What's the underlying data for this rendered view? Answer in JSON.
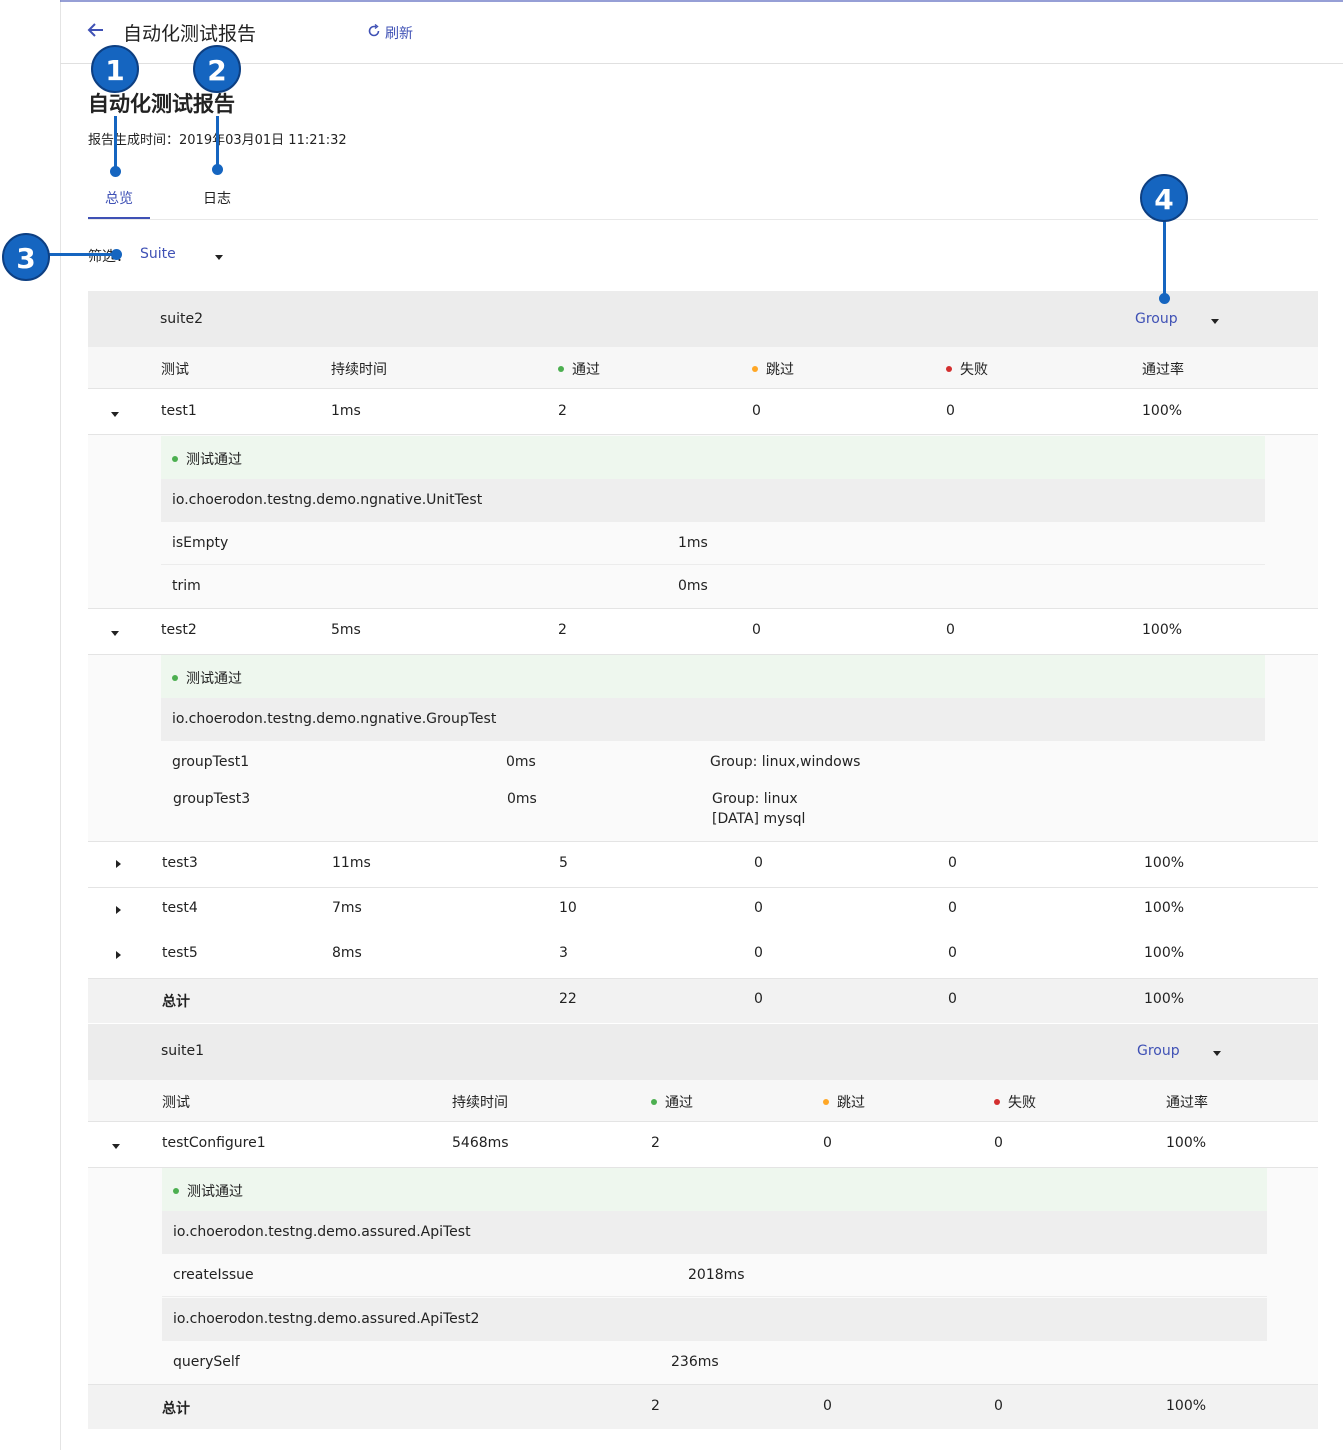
{
  "header": {
    "back_icon": "arrow-left-icon",
    "title": "自动化测试报告",
    "refresh_label": "刷新",
    "refresh_icon": "refresh-icon"
  },
  "page": {
    "title": "自动化测试报告",
    "generated_time": "报告生成时间：2019年03月01日 11:21:32"
  },
  "tabs": [
    {
      "label": "总览",
      "active": true
    },
    {
      "label": "日志",
      "active": false
    }
  ],
  "filter": {
    "label": "筛选：",
    "value": "Suite"
  },
  "colors": {
    "accent": "#3f51b5",
    "pass": "#4caf50",
    "skip": "#ffa726",
    "fail": "#d32f2f",
    "callout": "#1565c0"
  },
  "callouts": [
    "1",
    "2",
    "3",
    "4"
  ],
  "suites": [
    {
      "name": "suite2",
      "group_label": "Group",
      "columns": [
        "测试",
        "持续时间",
        "通过",
        "跳过",
        "失败",
        "通过率"
      ],
      "rows": [
        {
          "name": "test1",
          "duration": "1ms",
          "pass": "2",
          "skip": "0",
          "fail": "0",
          "rate": "100%",
          "expanded": true,
          "detail": {
            "status": "测试通过",
            "classes": [
              {
                "name": "io.choerodon.testng.demo.ngnative.UnitTest",
                "methods": [
                  {
                    "name": "isEmpty",
                    "duration": "1ms"
                  },
                  {
                    "name": "trim",
                    "duration": "0ms"
                  }
                ]
              }
            ]
          }
        },
        {
          "name": "test2",
          "duration": "5ms",
          "pass": "2",
          "skip": "0",
          "fail": "0",
          "rate": "100%",
          "expanded": true,
          "detail": {
            "status": "测试通过",
            "classes": [
              {
                "name": "io.choerodon.testng.demo.ngnative.GroupTest",
                "methods": [
                  {
                    "name": "groupTest1",
                    "duration": "0ms",
                    "info": "Group: linux,windows"
                  },
                  {
                    "name": "groupTest3",
                    "duration": "0ms",
                    "info": "Group: linux",
                    "info2": "[DATA] mysql"
                  }
                ]
              }
            ]
          }
        },
        {
          "name": "test3",
          "duration": "11ms",
          "pass": "5",
          "skip": "0",
          "fail": "0",
          "rate": "100%",
          "expanded": false
        },
        {
          "name": "test4",
          "duration": "7ms",
          "pass": "10",
          "skip": "0",
          "fail": "0",
          "rate": "100%",
          "expanded": false
        },
        {
          "name": "test5",
          "duration": "8ms",
          "pass": "3",
          "skip": "0",
          "fail": "0",
          "rate": "100%",
          "expanded": false
        }
      ],
      "total": {
        "label": "总计",
        "pass": "22",
        "skip": "0",
        "fail": "0",
        "rate": "100%"
      }
    },
    {
      "name": "suite1",
      "group_label": "Group",
      "columns": [
        "测试",
        "持续时间",
        "通过",
        "跳过",
        "失败",
        "通过率"
      ],
      "rows": [
        {
          "name": "testConfigure1",
          "duration": "5468ms",
          "pass": "2",
          "skip": "0",
          "fail": "0",
          "rate": "100%",
          "expanded": true,
          "detail": {
            "status": "测试通过",
            "classes": [
              {
                "name": "io.choerodon.testng.demo.assured.ApiTest",
                "methods": [
                  {
                    "name": "createIssue",
                    "duration": "2018ms"
                  }
                ]
              },
              {
                "name": "io.choerodon.testng.demo.assured.ApiTest2",
                "methods": [
                  {
                    "name": "querySelf",
                    "duration": "236ms"
                  }
                ]
              }
            ]
          }
        }
      ],
      "total": {
        "label": "总计",
        "pass": "2",
        "skip": "0",
        "fail": "0",
        "rate": "100%"
      }
    }
  ]
}
